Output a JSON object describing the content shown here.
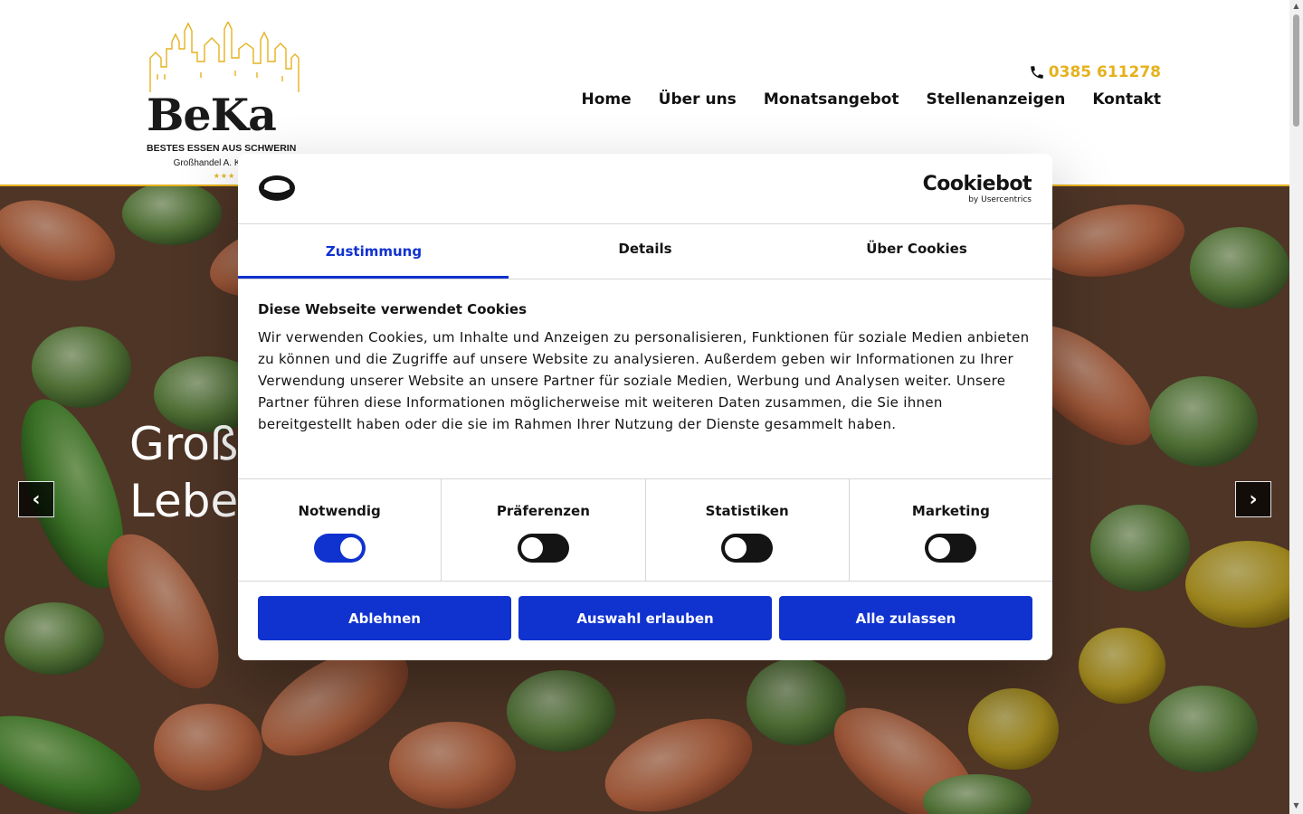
{
  "header": {
    "logo": {
      "brand": "BeKa",
      "tagline": "BESTES ESSEN AUS SCHWERIN",
      "sub": "Großhandel A. Kaufmann",
      "stars": "★★★"
    },
    "phone": "0385 611278",
    "nav": [
      "Home",
      "Über uns",
      "Monatsangebot",
      "Stellenanzeigen",
      "Kontakt"
    ]
  },
  "hero": {
    "line1": "Groß",
    "line2": "Leben",
    "prev": "‹",
    "next": "›"
  },
  "cookie": {
    "brand": "Cookiebot",
    "brand_sub": "by Usercentrics",
    "tabs": [
      "Zustimmung",
      "Details",
      "Über Cookies"
    ],
    "title": "Diese Webseite verwendet Cookies",
    "text": "Wir verwenden Cookies, um Inhalte und Anzeigen zu personalisieren, Funktionen für soziale Medien anbieten zu können und die Zugriffe auf unsere Website zu analysieren. Außerdem geben wir Informationen zu Ihrer Verwendung unserer Website an unsere Partner für soziale Medien, Werbung und Analysen weiter. Unsere Partner führen diese Informationen möglicherweise mit weiteren Daten zusammen, die Sie ihnen bereitgestellt haben oder die sie im Rahmen Ihrer Nutzung der Dienste gesammelt haben.",
    "toggles": [
      {
        "label": "Notwendig",
        "on": true
      },
      {
        "label": "Präferenzen",
        "on": false
      },
      {
        "label": "Statistiken",
        "on": false
      },
      {
        "label": "Marketing",
        "on": false
      }
    ],
    "buttons": [
      "Ablehnen",
      "Auswahl erlauben",
      "Alle zulassen"
    ]
  },
  "colors": {
    "accent": "#e5b21e",
    "cookie_blue": "#1032cf"
  }
}
